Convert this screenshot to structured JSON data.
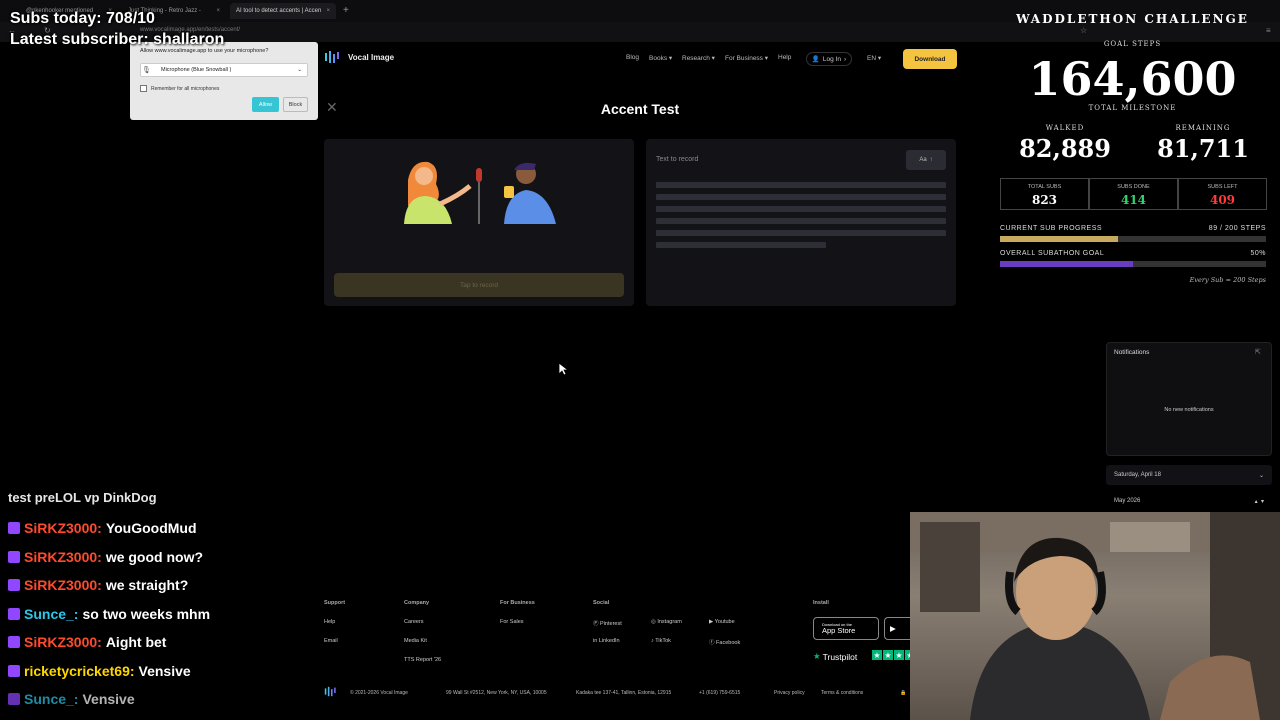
{
  "browser": {
    "tabs": [
      {
        "label": "@nkenhooker mentioned",
        "active": false
      },
      {
        "label": "Just Thinking - Retro Jazz -",
        "active": false
      },
      {
        "label": "AI tool to detect accents | Accen",
        "active": true
      }
    ],
    "url": "www.vocalimage.app/en/tests/accent/"
  },
  "permission_popup": {
    "title": "Allow www.vocalimage.app to use your microphone?",
    "device": "Microphone (Blue Snowball )",
    "remember_label": "Remember for all microphones",
    "allow_label": "Allow",
    "block_label": "Block"
  },
  "site": {
    "brand": "Vocal Image",
    "nav": {
      "blog": "Blog",
      "books": "Books",
      "research": "Research",
      "for_business": "For Business",
      "help": "Help",
      "login": "Log In",
      "lang": "EN",
      "download": "Download"
    },
    "page_title": "Accent Test",
    "record_button": "Tap to record",
    "text_to_record": "Text to record",
    "font_button": "Aa"
  },
  "footer": {
    "support": {
      "heading": "Support",
      "links": [
        "Help",
        "Email"
      ]
    },
    "company": {
      "heading": "Company",
      "links": [
        "Careers",
        "Media Kit",
        "TTS Report '26"
      ]
    },
    "business": {
      "heading": "For Business",
      "links": [
        "For Sales"
      ]
    },
    "social": {
      "heading": "Social",
      "links": [
        "Pinterest",
        "Instagram",
        "Youtube",
        "LinkedIn",
        "TikTok",
        "Facebook"
      ]
    },
    "install": {
      "heading": "Install",
      "app_store": "App Store",
      "app_store_pre": "Download on the",
      "trustpilot": "Trustpilot"
    },
    "copyright": "© 2021-2026 Vocal Image",
    "address1": "99 Wall St #2512, New York, NY, USA, 10005",
    "address2": "Kadaka tee 137-41, Tallinn, Estonia, 12915",
    "phone": "+1 (619) 759-6515",
    "privacy": "Privacy policy",
    "terms": "Terms & conditions"
  },
  "overlay": {
    "subs_today": "Subs today: 708/10",
    "latest_subscriber": "Latest subscriber: shallaron"
  },
  "chat": {
    "partial_top": "test preLOL vp DinkDog",
    "messages": [
      {
        "user": "SiRKZ3000",
        "text": "YouGoodMud",
        "color": "#ff4a2b"
      },
      {
        "user": "SiRKZ3000",
        "text": "we good now?",
        "color": "#ff4a2b"
      },
      {
        "user": "SiRKZ3000",
        "text": "we straight?",
        "color": "#ff4a2b"
      },
      {
        "user": "Sunce_",
        "text": "so two weeks mhm",
        "color": "#2ec7e8"
      },
      {
        "user": "SiRKZ3000",
        "text": "Aight bet",
        "color": "#ff4a2b"
      },
      {
        "user": "ricketycricket69",
        "text": "Vensive",
        "color": "#ffd700"
      },
      {
        "user": "Sunce_",
        "text": "Vensive",
        "color": "#2ec7e8"
      }
    ]
  },
  "stats": {
    "title": "WADDLETHON CHALLENGE",
    "goal_label": "GOAL STEPS",
    "goal_value": "164,600",
    "milestone_label": "TOTAL MILESTONE",
    "walked_label": "WALKED",
    "walked_value": "82,889",
    "remaining_label": "REMAINING",
    "remaining_value": "81,711",
    "total_subs_label": "TOTAL SUBS",
    "total_subs_value": "823",
    "subs_done_label": "SUBS DONE",
    "subs_done_value": "414",
    "subs_left_label": "SUBS LEFT",
    "subs_left_value": "409",
    "current_sub_label": "CURRENT SUB PROGRESS",
    "current_sub_value": "89 / 200 STEPS",
    "current_sub_fraction": 0.445,
    "overall_label": "OVERALL SUBATHON GOAL",
    "overall_value": "50%",
    "overall_fraction": 0.5,
    "footnote": "Every Sub = 200 Steps",
    "colors": {
      "subs_done": "#2bd66a",
      "subs_left": "#ff3b3b",
      "current_bar": "#c8aa5e",
      "overall_bar": "#6a3cc0"
    }
  },
  "notifications": {
    "title": "Notifications",
    "empty": "No new notifications",
    "date": "Saturday, April 18",
    "month": "May 2026"
  }
}
